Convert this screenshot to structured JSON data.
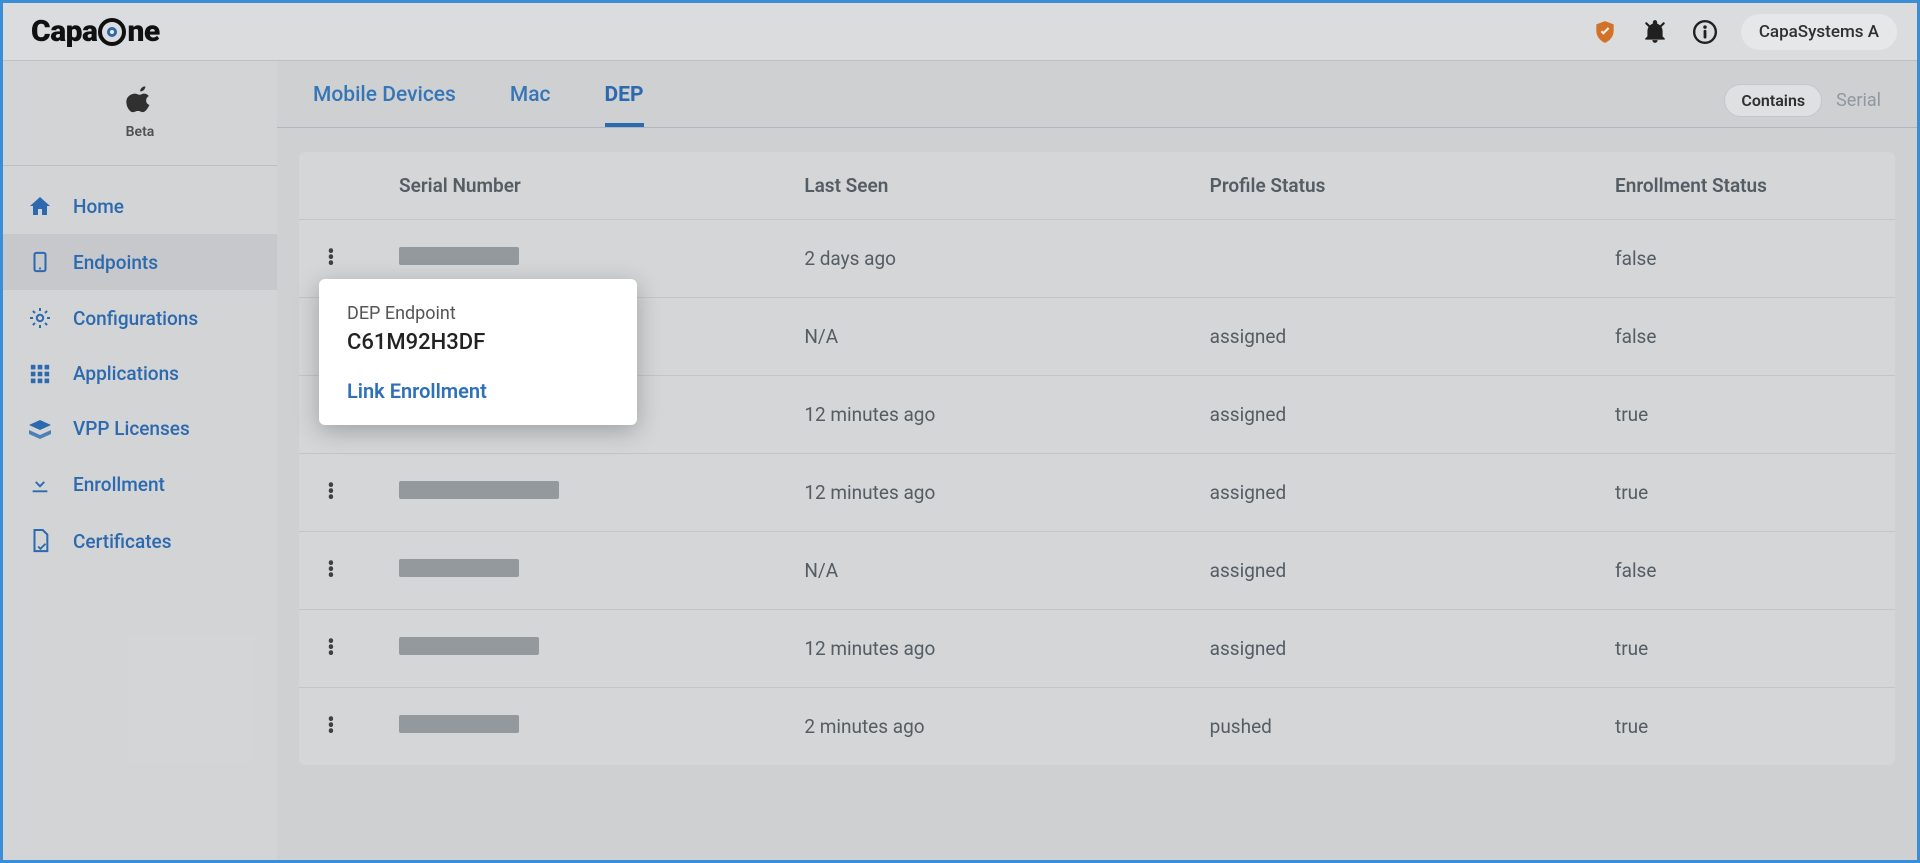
{
  "header": {
    "logo_text_pre": "Capa",
    "logo_text_post": "ne",
    "org_name": "CapaSystems A"
  },
  "sidebar_top": {
    "beta_label": "Beta"
  },
  "nav": {
    "items": [
      {
        "key": "home",
        "label": "Home"
      },
      {
        "key": "endpoints",
        "label": "Endpoints",
        "active": true
      },
      {
        "key": "configurations",
        "label": "Configurations"
      },
      {
        "key": "applications",
        "label": "Applications"
      },
      {
        "key": "vpp",
        "label": "VPP Licenses"
      },
      {
        "key": "enrollment",
        "label": "Enrollment"
      },
      {
        "key": "certificates",
        "label": "Certificates"
      }
    ]
  },
  "tabs": {
    "items": [
      {
        "key": "mobile",
        "label": "Mobile Devices"
      },
      {
        "key": "mac",
        "label": "Mac"
      },
      {
        "key": "dep",
        "label": "DEP",
        "active": true
      }
    ],
    "filter_pill": "Contains",
    "filter_field_label": "Serial"
  },
  "table": {
    "headers": {
      "serial": "Serial Number",
      "last_seen": "Last Seen",
      "profile_status": "Profile Status",
      "enrollment_status": "Enrollment Status"
    },
    "rows": [
      {
        "serial": "",
        "last_seen": "2 days ago",
        "profile_status": "",
        "enrollment_status": "false",
        "redact_w": 120
      },
      {
        "serial": "",
        "last_seen": "N/A",
        "profile_status": "assigned",
        "enrollment_status": "false",
        "redact_w": 120
      },
      {
        "serial": "",
        "last_seen": "12 minutes ago",
        "profile_status": "assigned",
        "enrollment_status": "true",
        "redact_w": 120
      },
      {
        "serial": "",
        "last_seen": "12 minutes ago",
        "profile_status": "assigned",
        "enrollment_status": "true",
        "redact_w": 160
      },
      {
        "serial": "",
        "last_seen": "N/A",
        "profile_status": "assigned",
        "enrollment_status": "false",
        "redact_w": 120
      },
      {
        "serial": "",
        "last_seen": "12 minutes ago",
        "profile_status": "assigned",
        "enrollment_status": "true",
        "redact_w": 140
      },
      {
        "serial": "",
        "last_seen": "2 minutes ago",
        "profile_status": "pushed",
        "enrollment_status": "true",
        "redact_w": 120
      }
    ]
  },
  "popover": {
    "title": "DEP Endpoint",
    "serial": "C61M92H3DF",
    "link_label": "Link Enrollment"
  }
}
